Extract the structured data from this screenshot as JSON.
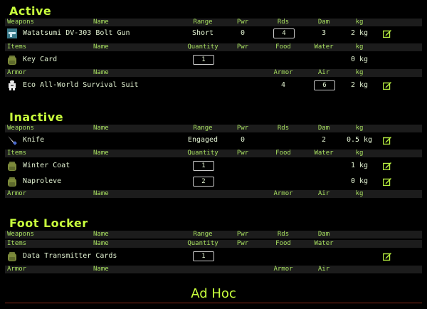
{
  "sections": {
    "active": {
      "title": "Active",
      "weapons_header": {
        "category": "Weapons",
        "name": "Name",
        "range": "Range",
        "pwr": "Pwr",
        "rds": "Rds",
        "dam": "Dam",
        "kg": "kg"
      },
      "weapons": [
        {
          "name": "Watatsumi DV-303 Bolt Gun",
          "range": "Short",
          "pwr": "0",
          "rds": "4",
          "dam": "3",
          "kg": "2 kg",
          "icon": "gun-icon"
        }
      ],
      "items_header": {
        "category": "Items",
        "name": "Name",
        "quantity": "Quantity",
        "pwr": "Pwr",
        "food": "Food",
        "water": "Water",
        "kg": "kg"
      },
      "items": [
        {
          "name": "Key Card",
          "quantity": "1",
          "kg": "0 kg",
          "icon": "backpack-icon"
        }
      ],
      "armor_header": {
        "category": "Armor",
        "name": "Name",
        "armor": "Armor",
        "air": "Air",
        "kg": "kg"
      },
      "armor": [
        {
          "name": "Eco All-World Survival Suit",
          "armor": "4",
          "air": "6",
          "kg": "2 kg",
          "icon": "suit-icon"
        }
      ]
    },
    "inactive": {
      "title": "Inactive",
      "weapons_header": {
        "category": "Weapons",
        "name": "Name",
        "range": "Range",
        "pwr": "Pwr",
        "rds": "Rds",
        "dam": "Dam",
        "kg": "kg"
      },
      "weapons": [
        {
          "name": "Knife",
          "range": "Engaged",
          "pwr": "0",
          "dam": "2",
          "kg": "0.5 kg",
          "icon": "knife-icon"
        }
      ],
      "items_header": {
        "category": "Items",
        "name": "Name",
        "quantity": "Quantity",
        "pwr": "Pwr",
        "food": "Food",
        "water": "Water",
        "kg": "kg"
      },
      "items": [
        {
          "name": "Winter Coat",
          "quantity": "1",
          "kg": "1 kg",
          "icon": "backpack-icon"
        },
        {
          "name": "Naproleve",
          "quantity": "2",
          "kg": "0 kg",
          "icon": "backpack-icon"
        }
      ],
      "armor_header": {
        "category": "Armor",
        "name": "Name",
        "armor": "Armor",
        "air": "Air",
        "kg": "kg"
      }
    },
    "foot_locker": {
      "title": "Foot Locker",
      "weapons_header": {
        "category": "Weapons",
        "name": "Name",
        "range": "Range",
        "pwr": "Pwr",
        "rds": "Rds",
        "dam": "Dam"
      },
      "items_header": {
        "category": "Items",
        "name": "Name",
        "quantity": "Quantity",
        "pwr": "Pwr",
        "food": "Food",
        "water": "Water"
      },
      "items": [
        {
          "name": "Data Transmitter Cards",
          "quantity": "1",
          "icon": "backpack-icon"
        }
      ],
      "armor_header": {
        "category": "Armor",
        "name": "Name",
        "armor": "Armor",
        "air": "Air"
      }
    },
    "ad_hoc": {
      "title": "Ad Hoc"
    }
  },
  "colors": {
    "title": "#c8ff3c",
    "header_text": "#a8e060",
    "header_bg": "#1c1c1c",
    "edit_icon": "#b8f040",
    "divider": "#8a2a18"
  }
}
